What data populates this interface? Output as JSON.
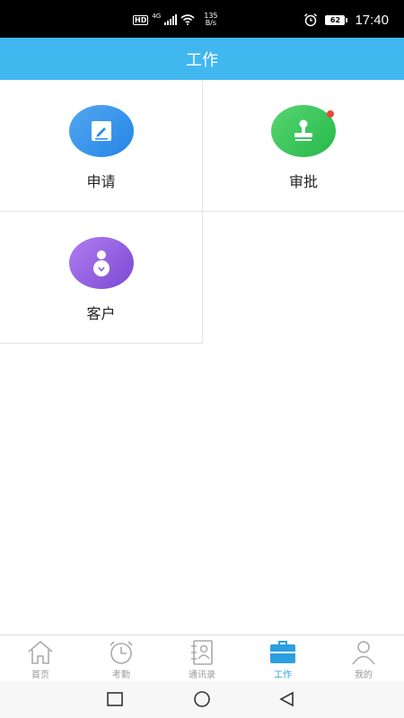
{
  "status_bar": {
    "hd": "HD",
    "network": "4G",
    "speed_value": "135",
    "speed_unit": "B/s",
    "battery": "62",
    "time": "17:40"
  },
  "header": {
    "title": "工作"
  },
  "grid": {
    "items": [
      {
        "label": "申请",
        "icon": "edit-icon",
        "color": "#3b97eb"
      },
      {
        "label": "审批",
        "icon": "stamp-icon",
        "color": "#3cc85a",
        "badge": true
      },
      {
        "label": "客户",
        "icon": "customer-icon",
        "color": "#955fe0"
      }
    ]
  },
  "bottom_nav": {
    "active": "工作",
    "items": [
      {
        "label": "首页",
        "icon": "home-icon"
      },
      {
        "label": "考勤",
        "icon": "alarm-clock-icon"
      },
      {
        "label": "通讯录",
        "icon": "contacts-icon"
      },
      {
        "label": "工作",
        "icon": "briefcase-icon"
      },
      {
        "label": "我的",
        "icon": "person-icon"
      }
    ]
  },
  "colors": {
    "header": "#41b7f0",
    "active_tab": "#2d9ee0",
    "inactive_tab": "#999999"
  }
}
